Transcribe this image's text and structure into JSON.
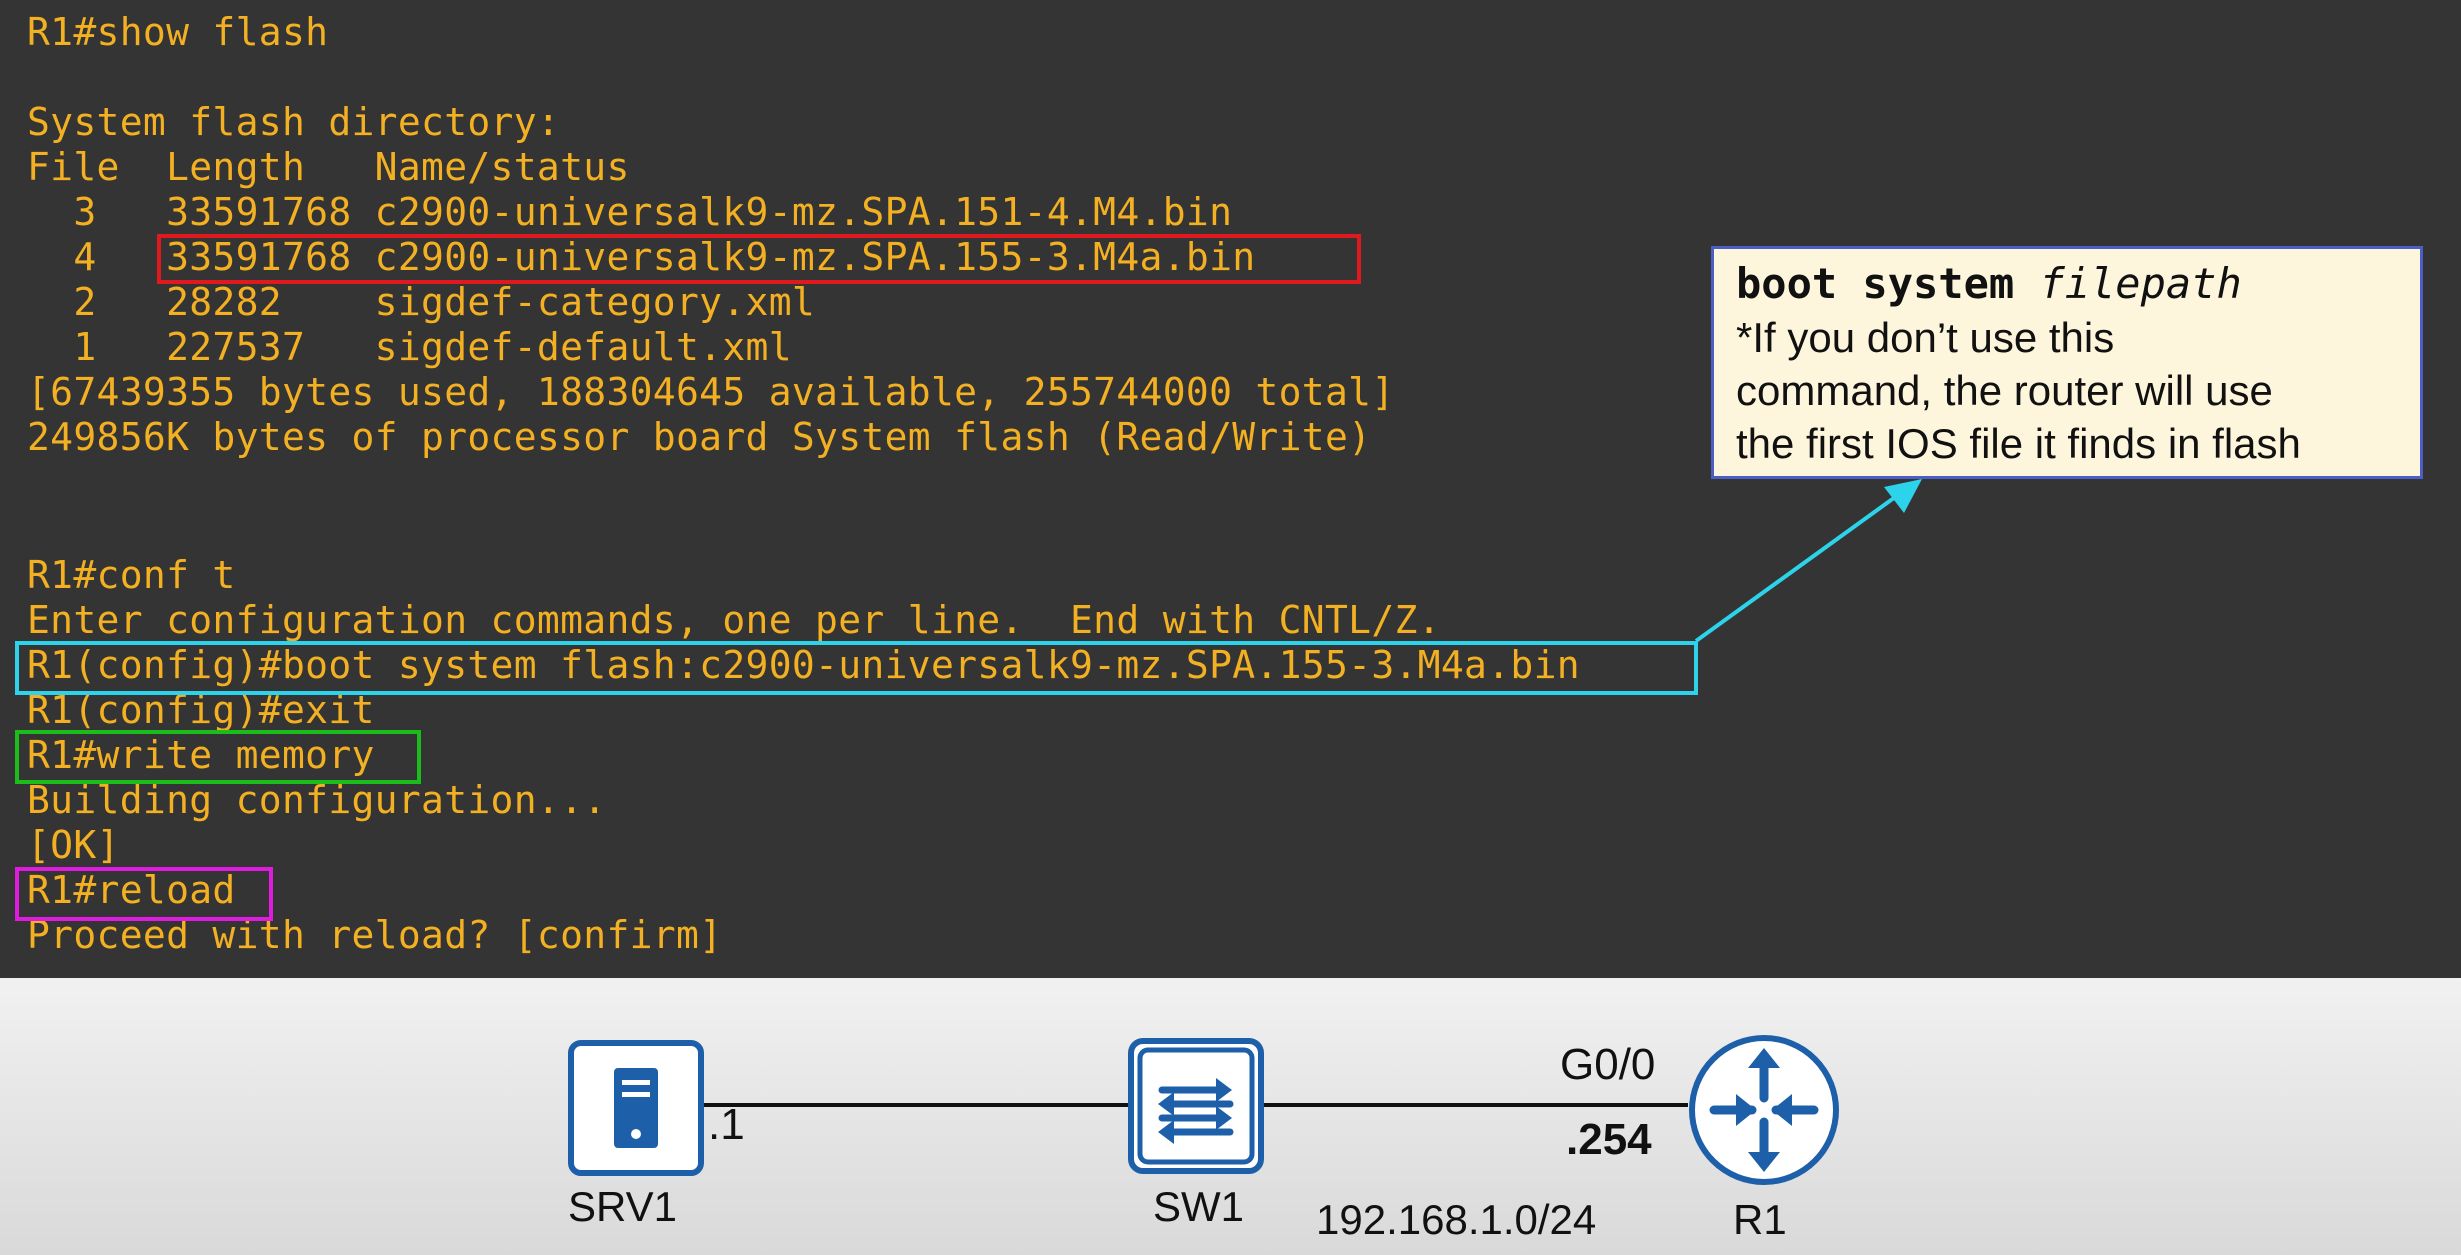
{
  "terminal": {
    "lines": [
      "R1#show flash",
      "",
      "System flash directory:",
      "File  Length   Name/status",
      "  3   33591768 c2900-universalk9-mz.SPA.151-4.M4.bin",
      "  4   33591768 c2900-universalk9-mz.SPA.155-3.M4a.bin",
      "  2   28282    sigdef-category.xml",
      "  1   227537   sigdef-default.xml",
      "[67439355 bytes used, 188304645 available, 255744000 total]",
      "249856K bytes of processor board System flash (Read/Write)",
      "",
      "",
      "R1#conf t",
      "Enter configuration commands, one per line.  End with CNTL/Z.",
      "R1(config)#boot system flash:c2900-universalk9-mz.SPA.155-3.M4a.bin",
      "R1(config)#exit",
      "R1#write memory",
      "Building configuration...",
      "[OK]",
      "R1#reload",
      "Proceed with reload? [confirm]"
    ]
  },
  "colors": {
    "terminal_bg": "#343434",
    "terminal_text": "#f2b022",
    "highlight_red": "#e0191f",
    "highlight_cyan": "#2cd3ea",
    "highlight_green": "#1bbd1b",
    "highlight_magenta": "#e01be0",
    "icon_blue": "#1d5fa8"
  },
  "callout": {
    "command_bold": "boot system",
    "command_italic": "filepath",
    "note_lines": [
      "*If you don’t use this",
      "command, the router will use",
      "the first IOS file it finds in flash"
    ]
  },
  "topology": {
    "srv_label": "SRV1",
    "srv_ip": ".1",
    "switch_label": "SW1",
    "router_label": "R1",
    "router_interface": "G0/0",
    "router_ip": ".254",
    "network": "192.168.1.0/24",
    "server_icon": "server-icon",
    "switch_icon": "switch-icon",
    "router_icon": "router-icon"
  }
}
